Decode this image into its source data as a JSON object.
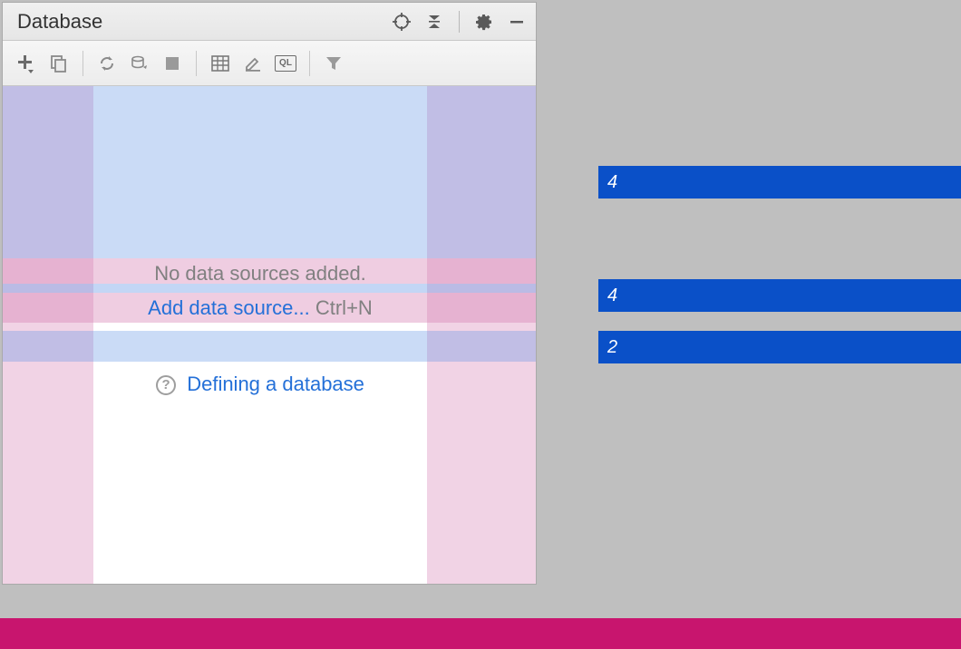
{
  "panel": {
    "title": "Database"
  },
  "headerIcons": {
    "target": "target-icon",
    "collapse": "collapse-all-icon",
    "gear": "gear-icon",
    "minimize": "minimize-icon"
  },
  "toolbarIcons": {
    "add": "add-icon",
    "duplicate": "duplicate-icon",
    "refresh": "refresh-icon",
    "ddl": "ddl-sync-icon",
    "stop": "stop-icon",
    "table": "table-icon",
    "edit": "edit-icon",
    "ql": "QL",
    "filter": "filter-icon"
  },
  "content": {
    "emptyMessage": "No data sources added.",
    "addLink": "Add data source...",
    "addShortcut": "Ctrl+N",
    "helpLink": "Defining a database"
  },
  "annotations": {
    "a1": "4",
    "a2": "4",
    "a3": "2"
  }
}
